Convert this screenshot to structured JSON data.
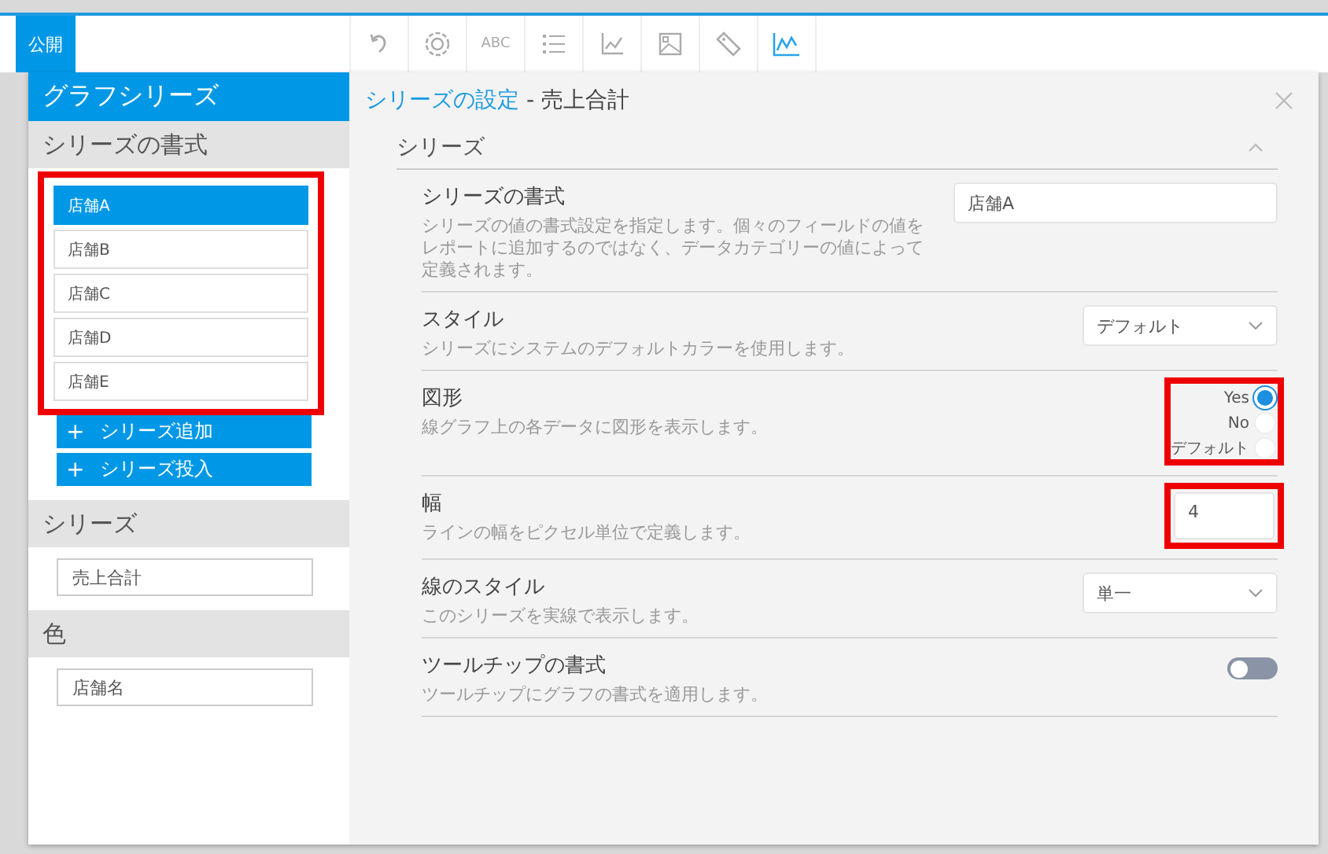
{
  "top_tab": {
    "label": "公開",
    "selected": true
  },
  "toolbar": [
    {
      "kind": "undo",
      "selected": false
    },
    {
      "kind": "gear",
      "selected": false
    },
    {
      "kind": "abc",
      "label": "ABC",
      "selected": false
    },
    {
      "kind": "list",
      "selected": false
    },
    {
      "kind": "axis",
      "selected": false
    },
    {
      "kind": "image",
      "selected": false
    },
    {
      "kind": "tag",
      "selected": false
    },
    {
      "kind": "linechart",
      "selected": true
    }
  ],
  "left_panel": {
    "title": "グラフシリーズ",
    "series_format": {
      "heading": "シリーズの書式",
      "highlighted": true,
      "items": [
        {
          "label": "店舗A",
          "selected": true
        },
        {
          "label": "店舗B",
          "selected": false
        },
        {
          "label": "店舗C",
          "selected": false
        },
        {
          "label": "店舗D",
          "selected": false
        },
        {
          "label": "店舗E",
          "selected": false
        }
      ],
      "buttons": [
        {
          "icon": "+",
          "label": "シリーズ追加"
        },
        {
          "icon": "+",
          "label": "シリーズ投入"
        }
      ]
    },
    "series": {
      "heading": "シリーズ",
      "value": "売上合計"
    },
    "color": {
      "heading": "色",
      "value": "店舗名"
    }
  },
  "right_panel": {
    "title": "シリーズの設定",
    "subtitle": " - 売上合計",
    "section": {
      "title": "シリーズ",
      "expanded": true
    },
    "rows": [
      {
        "kind": "text",
        "title": "シリーズの書式",
        "description": "シリーズの値の書式設定を指定します。個々のフィールドの値をレポートに追加するのではなく、データカテゴリーの値によって定義されます。",
        "value": "店舗A",
        "highlighted": false
      },
      {
        "kind": "select",
        "title": "スタイル",
        "description": "シリーズにシステムのデフォルトカラーを使用します。",
        "value": "デフォルト",
        "highlighted": false
      },
      {
        "kind": "radio",
        "title": "図形",
        "description": "線グラフ上の各データに図形を表示します。",
        "highlighted": true,
        "options": [
          {
            "label": "Yes",
            "selected": true
          },
          {
            "label": "No",
            "selected": false
          },
          {
            "label": "デフォルト",
            "selected": false
          }
        ]
      },
      {
        "kind": "number",
        "title": "幅",
        "description": "ラインの幅をピクセル単位で定義します。",
        "value": "4",
        "highlighted": true
      },
      {
        "kind": "select",
        "title": "線のスタイル",
        "description": "このシリーズを実線で表示します。",
        "value": "単一",
        "highlighted": false
      },
      {
        "kind": "toggle",
        "title": "ツールチップの書式",
        "description": "ツールチップにグラフの書式を適用します。",
        "on": false,
        "highlighted": false
      }
    ]
  }
}
